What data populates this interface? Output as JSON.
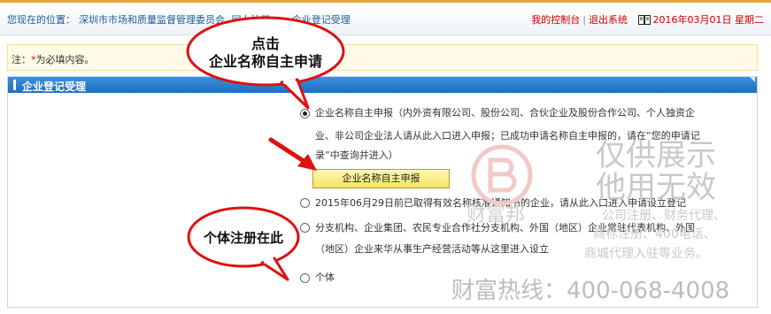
{
  "header": {
    "breadcrumb_prefix": "您现在的位置：",
    "breadcrumb_org": "深圳市市场和质量监督管理委员会",
    "breadcrumb_section": "网上注册",
    "breadcrumb_sep": ">",
    "breadcrumb_current": "企业登记受理",
    "my_console": "我的控制台",
    "logout": "退出系统",
    "divider": "|",
    "date": "2016年03月01日 星期二"
  },
  "notice": {
    "prefix": "注：",
    "star": "*",
    "text": "为必填内容。"
  },
  "panel": {
    "title": "企业登记受理"
  },
  "options": [
    {
      "selected": true,
      "line1": "企业名称自主申报（内外资有限公司、股份公司、合伙企业及股份合作公司、个人独资企",
      "line2": "业、非公司企业法人请从此入口进入申报；已成功申请名称自主申报的，请在“您的申请记",
      "line3": "录”中查询并进入）"
    },
    {
      "selected": false,
      "line1": "2015年06月29日前已取得有效名称核准通知书的企业，请从此入口进入申请设立登记"
    },
    {
      "selected": false,
      "line1": "分支机构、企业集团、农民专业合作社分支机构、外国（地区）企业常驻代表机构、外国",
      "line2": "（地区）企业来华从事生产经营活动等从这里进入设立"
    },
    {
      "selected": false,
      "line1": "个体"
    }
  ],
  "apply_button": {
    "label": "企业名称自主申报"
  },
  "callouts": {
    "top_line1": "点击",
    "top_line2": "企业名称自主申请",
    "bottom": "个体注册在此"
  },
  "watermark": {
    "brand": "财富邦",
    "line1": "仅供展示",
    "line2": "他用无效",
    "services1": "公司注册、财务代理、",
    "services2": "商标注册、400电话、",
    "services3": "商城代理入驻等业务。",
    "hotline": "财富热线：400-068-4008"
  },
  "colors": {
    "accent_blue": "#1e6fc0",
    "button_yellow": "#f6e36a",
    "arrow_red": "#e01010",
    "top_border_orange": "#e8a23a"
  }
}
